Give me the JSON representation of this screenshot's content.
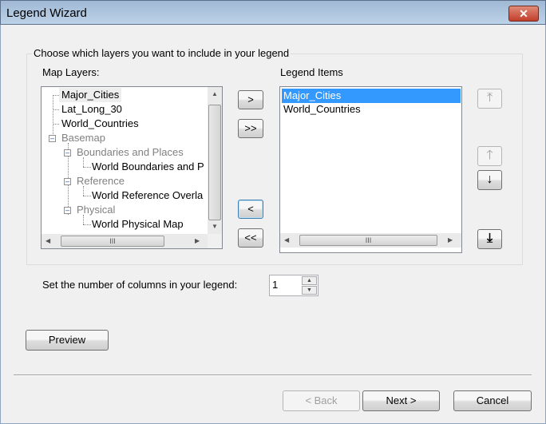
{
  "window": {
    "title": "Legend Wizard",
    "close_icon": "close-icon"
  },
  "group": {
    "label": "Choose which layers you want to include in your legend"
  },
  "map_layers": {
    "label": "Map Layers:",
    "items": [
      {
        "label": "Major_Cities",
        "level": 0,
        "enabled": true,
        "highlighted": true
      },
      {
        "label": "Lat_Long_30",
        "level": 0,
        "enabled": true
      },
      {
        "label": "World_Countries",
        "level": 0,
        "enabled": true
      },
      {
        "label": "Basemap",
        "level": 0,
        "enabled": false,
        "expanded": true
      },
      {
        "label": "Boundaries and Places",
        "level": 1,
        "enabled": false,
        "expanded": true
      },
      {
        "label": "World Boundaries and P",
        "level": 2,
        "enabled": true
      },
      {
        "label": "Reference",
        "level": 1,
        "enabled": false,
        "expanded": true
      },
      {
        "label": "World Reference Overla",
        "level": 2,
        "enabled": true
      },
      {
        "label": "Physical",
        "level": 1,
        "enabled": false,
        "expanded": true
      },
      {
        "label": "World Physical Map",
        "level": 2,
        "enabled": true
      }
    ]
  },
  "transfer": {
    "add": ">",
    "add_all": ">>",
    "remove": "<",
    "remove_all": "<<"
  },
  "legend_items": {
    "label": "Legend Items",
    "items": [
      "Major_Cities",
      "World_Countries"
    ],
    "selected": "Major_Cities"
  },
  "columns": {
    "label": "Set the number of columns in your legend:",
    "value": "1"
  },
  "buttons": {
    "preview": "Preview",
    "back": "< Back",
    "next": "Next >",
    "cancel": "Cancel"
  }
}
